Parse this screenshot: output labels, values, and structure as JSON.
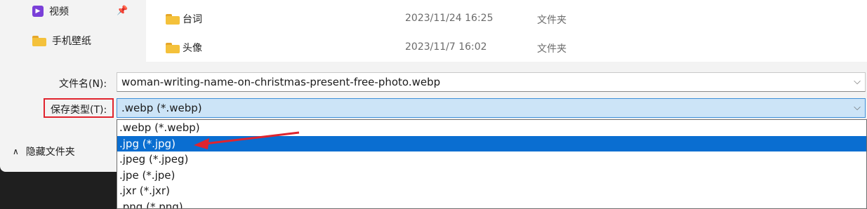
{
  "nav": {
    "items": [
      {
        "label": "视频",
        "icon": "video-icon",
        "pinned": true
      },
      {
        "label": "手机壁纸",
        "icon": "folder-icon",
        "pinned": false
      }
    ]
  },
  "files": [
    {
      "name": "台词",
      "date": "2023/11/24 16:25",
      "type": "文件夹"
    },
    {
      "name": "头像",
      "date": "2023/11/7 16:02",
      "type": "文件夹"
    }
  ],
  "filename": {
    "label": "文件名(N):",
    "value": "woman-writing-name-on-christmas-present-free-photo.webp"
  },
  "savetype": {
    "label": "保存类型(T):",
    "value": ".webp (*.webp)"
  },
  "hide_folders_label": "隐藏文件夹",
  "dropdown_options": [
    ".webp (*.webp)",
    ".jpg (*.jpg)",
    ".jpeg (*.jpeg)",
    ".jpe (*.jpe)",
    ".jxr (*.jxr)",
    ".png (*.png)"
  ],
  "selected_option_index": 1,
  "colors": {
    "selection": "#0a6ed1",
    "annotation": "#e0242e",
    "folder": "#f4c13b",
    "video": "#7a3fd8"
  }
}
